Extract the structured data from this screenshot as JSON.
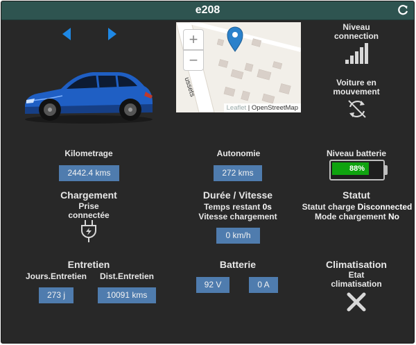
{
  "title": "e208",
  "icons": {
    "refresh": "refresh-icon",
    "prev": "chevron-left-icon",
    "next": "chevron-right-icon",
    "signal": "signal-bars-icon",
    "moving": "sync-arrows-icon",
    "plug": "plug-icon",
    "climate_off": "x-icon"
  },
  "map": {
    "zoom_in": "+",
    "zoom_out": "−",
    "street": "ussets",
    "attribution_leaflet": "Leaflet",
    "attribution_sep": " | ",
    "attribution_osm": "OpenStreetMap"
  },
  "connection": {
    "label": "Niveau connection",
    "bars_lit": 5,
    "bars_total": 5
  },
  "moving": {
    "label": "Voiture en mouvement"
  },
  "odometer": {
    "label": "Kilometrage",
    "value": "2442.4 kms"
  },
  "autonomy": {
    "label": "Autonomie",
    "value": "272 kms"
  },
  "battery_level": {
    "label": "Niveau batterie",
    "value": "88%",
    "fraction": 0.88,
    "color": "#0fa30f"
  },
  "charging": {
    "title": "Chargement",
    "plug_label": "Prise connectée"
  },
  "duration": {
    "title": "Durée / Vitesse",
    "remaining_label": "Temps restant",
    "remaining_value": "0s",
    "speed_label": "Vitesse chargement",
    "speed_value": "0 km/h"
  },
  "status": {
    "title": "Statut",
    "charge_label": "Statut charge",
    "charge_value": "Disconnected",
    "mode_label": "Mode chargement",
    "mode_value": "No"
  },
  "maintenance": {
    "title": "Entretien",
    "days_label": "Jours.Entretien",
    "days_value": "273 j",
    "dist_label": "Dist.Entretien",
    "dist_value": "10091 kms"
  },
  "battery": {
    "title": "Batterie",
    "voltage": "92 V",
    "current": "0 A"
  },
  "climate": {
    "title": "Climatisation",
    "state_label": "Etat climatisation"
  },
  "colors": {
    "accent": "#1e88e5",
    "value_bg": "#4f7cae",
    "header": "#2e5450",
    "panel": "#282828"
  }
}
